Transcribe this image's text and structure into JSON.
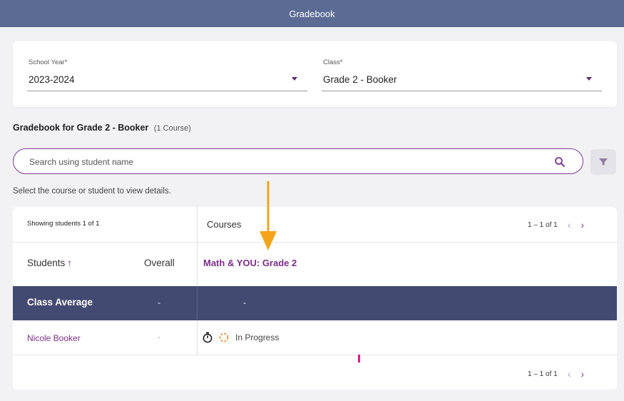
{
  "header": {
    "title": "Gradebook"
  },
  "filters": {
    "school_year": {
      "label": "School Year*",
      "value": "2023-2024"
    },
    "class": {
      "label": "Class*",
      "value": "Grade 2 - Booker"
    }
  },
  "gradebook": {
    "title": "Gradebook for Grade 2 - Booker",
    "course_count": "(1 Course)"
  },
  "search": {
    "placeholder": "Search using student name"
  },
  "hint": "Select the course or student to view details.",
  "table": {
    "showing": "Showing students 1 of 1",
    "courses_label": "Courses",
    "pagination_top": "1 – 1 of 1",
    "pagination_bottom": "1 – 1 of 1",
    "students_label": "Students",
    "sort_indicator": "↑",
    "overall_label": "Overall",
    "course_name": "Math & YOU: Grade 2",
    "class_average": {
      "label": "Class Average",
      "overall": "-",
      "course": "-"
    },
    "rows": [
      {
        "name": "Nicole Booker",
        "overall": "-",
        "status": "In Progress"
      }
    ]
  },
  "icons": {
    "search": "search-icon",
    "filter": "filter-icon",
    "prev": "chevron-left-icon",
    "next": "chevron-right-icon",
    "timer": "stopwatch-icon",
    "progress": "in-progress-icon"
  },
  "colors": {
    "header_bg": "#5c6b94",
    "accent": "#7b3b8f",
    "average_row_bg": "#434a72",
    "annotation_arrow": "#f5a41a",
    "in_progress": "#f07e1e"
  }
}
